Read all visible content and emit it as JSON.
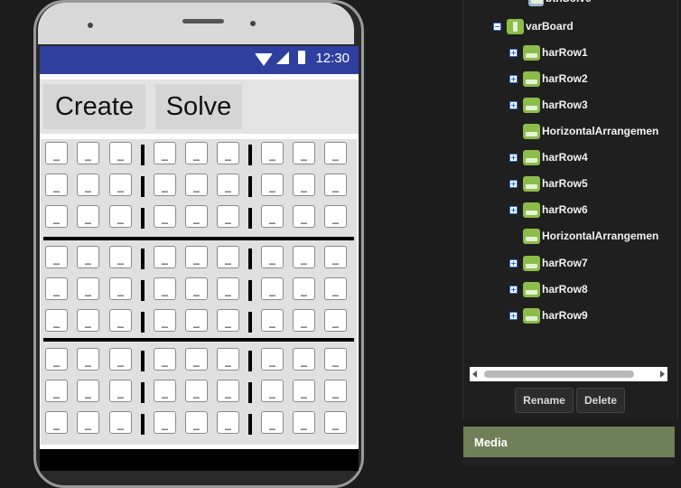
{
  "phone": {
    "status_time": "12:30",
    "buttons": {
      "create": "Create",
      "solve": "Solve"
    },
    "board": {
      "cell_text": "_",
      "rows": 9,
      "cols": 9
    }
  },
  "components_panel": {
    "clipped_item": "btnSolve",
    "tree": [
      {
        "label": "varBoard",
        "toggle": "minus",
        "icon": "vertical-arrangement-icon"
      },
      {
        "label": "harRow1",
        "toggle": "plus",
        "icon": "horizontal-arrangement-icon"
      },
      {
        "label": "harRow2",
        "toggle": "plus",
        "icon": "horizontal-arrangement-icon"
      },
      {
        "label": "harRow3",
        "toggle": "plus",
        "icon": "horizontal-arrangement-icon"
      },
      {
        "label": "HorizontalArrangemen",
        "toggle": "none",
        "icon": "horizontal-arrangement-icon"
      },
      {
        "label": "harRow4",
        "toggle": "plus",
        "icon": "horizontal-arrangement-icon"
      },
      {
        "label": "harRow5",
        "toggle": "plus",
        "icon": "horizontal-arrangement-icon"
      },
      {
        "label": "harRow6",
        "toggle": "plus",
        "icon": "horizontal-arrangement-icon"
      },
      {
        "label": "HorizontalArrangemen",
        "toggle": "none",
        "icon": "horizontal-arrangement-icon"
      },
      {
        "label": "harRow7",
        "toggle": "plus",
        "icon": "horizontal-arrangement-icon"
      },
      {
        "label": "harRow8",
        "toggle": "plus",
        "icon": "horizontal-arrangement-icon"
      },
      {
        "label": "harRow9",
        "toggle": "plus",
        "icon": "horizontal-arrangement-icon"
      }
    ],
    "rename_label": "Rename",
    "delete_label": "Delete"
  },
  "media_panel": {
    "title": "Media"
  },
  "colors": {
    "status_bar": "#2e3fa0",
    "component_icon": "#8cbc4a",
    "media_header": "#6f7f58"
  }
}
